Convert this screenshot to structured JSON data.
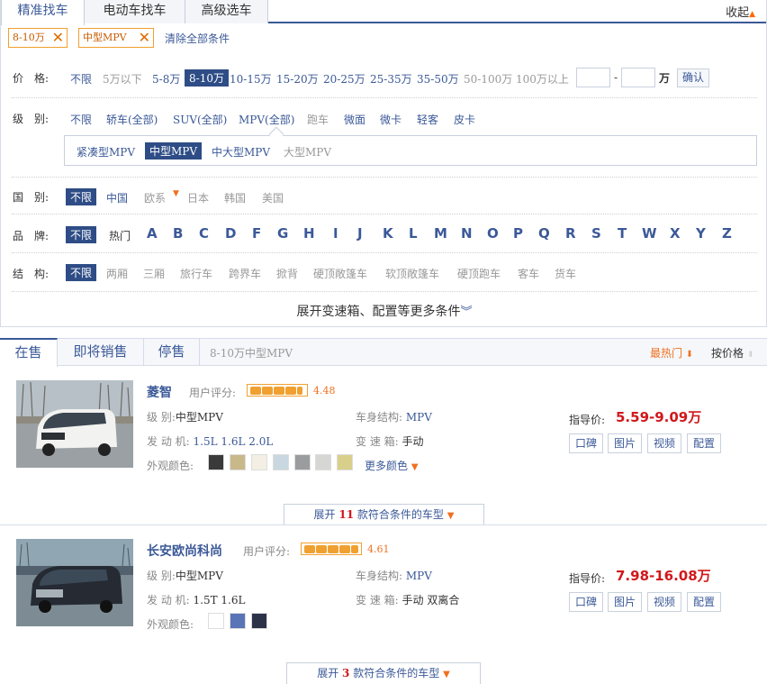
{
  "filter_tabs": [
    "精准找车",
    "电动车找车",
    "高级选车"
  ],
  "collapse_label": "收起",
  "selected_chips": [
    "8-10万",
    "中型MPV"
  ],
  "clear_all": "清除全部条件",
  "price": {
    "label": "价　格:",
    "options": [
      "不限",
      "5万以下",
      "5-8万",
      "8-10万",
      "10-15万",
      "15-20万",
      "20-25万",
      "25-35万",
      "35-50万",
      "50-100万",
      "100万以上"
    ],
    "selected": "8-10万",
    "range_dash": "-",
    "unit": "万",
    "confirm": "确认"
  },
  "level": {
    "label": "级　别:",
    "options": [
      "不限",
      "轿车(全部)",
      "SUV(全部)",
      "MPV(全部)",
      "跑车",
      "微面",
      "微卡",
      "轻客",
      "皮卡"
    ],
    "sub_options": [
      "紧凑型MPV",
      "中型MPV",
      "中大型MPV",
      "大型MPV"
    ],
    "sub_selected": "中型MPV"
  },
  "country": {
    "label": "国　别:",
    "options": [
      "不限",
      "中国",
      "欧系",
      "日本",
      "韩国",
      "美国"
    ]
  },
  "brand": {
    "label": "品　牌:",
    "options": [
      "不限",
      "热门"
    ],
    "letters": [
      "A",
      "B",
      "C",
      "D",
      "F",
      "G",
      "H",
      "I",
      "J",
      "K",
      "L",
      "M",
      "N",
      "O",
      "P",
      "Q",
      "R",
      "S",
      "T",
      "W",
      "X",
      "Y",
      "Z"
    ]
  },
  "structure": {
    "label": "结　构:",
    "options": [
      "不限",
      "两厢",
      "三厢",
      "旅行车",
      "跨界车",
      "掀背",
      "硬顶敞篷车",
      "软顶敞篷车",
      "硬顶跑车",
      "客车",
      "货车"
    ]
  },
  "expand_more": "展开变速箱、配置等更多条件",
  "result_tabs": [
    "在售",
    "即将销售",
    "停售"
  ],
  "result_summary": "8-10万中型MPV",
  "sort_hot": "最热门",
  "sort_price": "按价格",
  "cars": [
    {
      "name": "菱智",
      "rating_label": "用户评分:",
      "rating": "4.48",
      "level_label": "级  别:",
      "level": "中型MPV",
      "engine_label": "发 动 机:",
      "engine": "1.5L 1.6L 2.0L",
      "body_label": "车身结构:",
      "body": "MPV",
      "gearbox_label": "变 速 箱:",
      "gearbox": "手动",
      "color_label": "外观颜色:",
      "colors": [
        "#3a3a3a",
        "#c9b88a",
        "#f3efe4",
        "#c8d7e0",
        "#9a9c9e",
        "#d6d6d4",
        "#d8d08a"
      ],
      "more_colors": "更多颜色",
      "price_label": "指导价:",
      "price": "5.59-9.09万",
      "actions": [
        "口碑",
        "图片",
        "视频",
        "配置"
      ],
      "expand_prefix": "展开",
      "expand_count": "11",
      "expand_suffix": "款符合条件的车型"
    },
    {
      "name": "长安欧尚科尚",
      "rating_label": "用户评分:",
      "rating": "4.61",
      "level_label": "级  别:",
      "level": "中型MPV",
      "engine_label": "发 动 机:",
      "engine": "1.5T 1.6L",
      "body_label": "车身结构:",
      "body": "MPV",
      "gearbox_label": "变 速 箱:",
      "gearbox": "手动 双离合",
      "color_label": "外观颜色:",
      "colors": [
        "#ffffff",
        "#5a74b8",
        "#2c3348"
      ],
      "price_label": "指导价:",
      "price": "7.98-16.08万",
      "actions": [
        "口碑",
        "图片",
        "视频",
        "配置"
      ],
      "expand_prefix": "展开",
      "expand_count": "3",
      "expand_suffix": "款符合条件的车型"
    }
  ]
}
